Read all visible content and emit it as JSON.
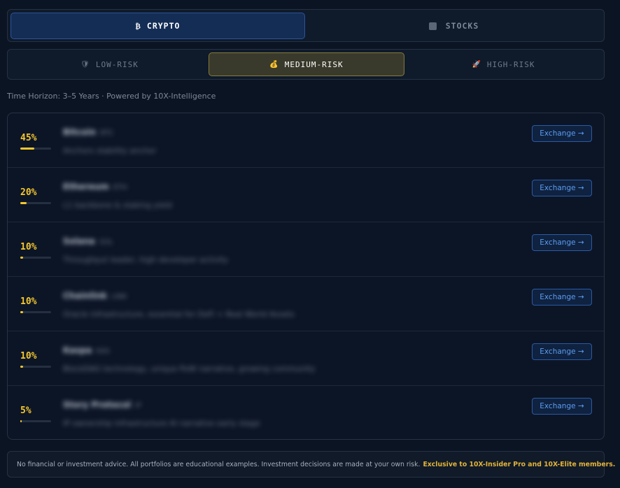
{
  "asset_tabs": {
    "crypto": {
      "icon": "₿",
      "label": "CRYPTO",
      "active": true
    },
    "stocks": {
      "icon": "chart-icon",
      "label": "STOCKS",
      "active": false
    }
  },
  "risk_tabs": {
    "low": {
      "icon": "🛡",
      "label": "LOW-RISK"
    },
    "medium": {
      "icon": "💰",
      "label": "MEDIUM-RISK",
      "active": true
    },
    "high": {
      "icon": "🚀",
      "label": "HIGH-RISK"
    }
  },
  "subtitle": "Time Horizon: 3–5 Years · Powered by 10X-Intelligence",
  "colors": {
    "accent_yellow": "#f5c72e",
    "accent_blue": "#5b9cf0",
    "background": "#0b1423"
  },
  "holdings": [
    {
      "pct": "45%",
      "allocation": 45,
      "name": "Bitcoin",
      "ticker": "BTC",
      "desc": "Anchors stability anchor",
      "exchange_label": "Exchange →"
    },
    {
      "pct": "20%",
      "allocation": 20,
      "name": "Ethereum",
      "ticker": "ETH",
      "desc": "L1 backbone & staking yield",
      "exchange_label": "Exchange →"
    },
    {
      "pct": "10%",
      "allocation": 10,
      "name": "Solana",
      "ticker": "SOL",
      "desc": "Throughput leader, high developer activity",
      "exchange_label": "Exchange →"
    },
    {
      "pct": "10%",
      "allocation": 10,
      "name": "Chainlink",
      "ticker": "LINK",
      "desc": "Oracle infrastructure, essential for DeFi + Real World Assets",
      "exchange_label": "Exchange →"
    },
    {
      "pct": "10%",
      "allocation": 10,
      "name": "Kaspa",
      "ticker": "KAS",
      "desc": "BlockDAG technology, unique PoW narrative, growing community",
      "exchange_label": "Exchange →"
    },
    {
      "pct": "5%",
      "allocation": 5,
      "name": "Story Protocol",
      "ticker": "IP",
      "desc": "IP ownership infrastructure AI narrative early stage",
      "exchange_label": "Exchange →"
    }
  ],
  "disclaimer": {
    "text": "No financial or investment advice. All portfolios are educational examples. Investment decisions are made at your own risk.",
    "highlight": "Exclusive to 10X-Insider Pro and 10X-Elite members."
  }
}
